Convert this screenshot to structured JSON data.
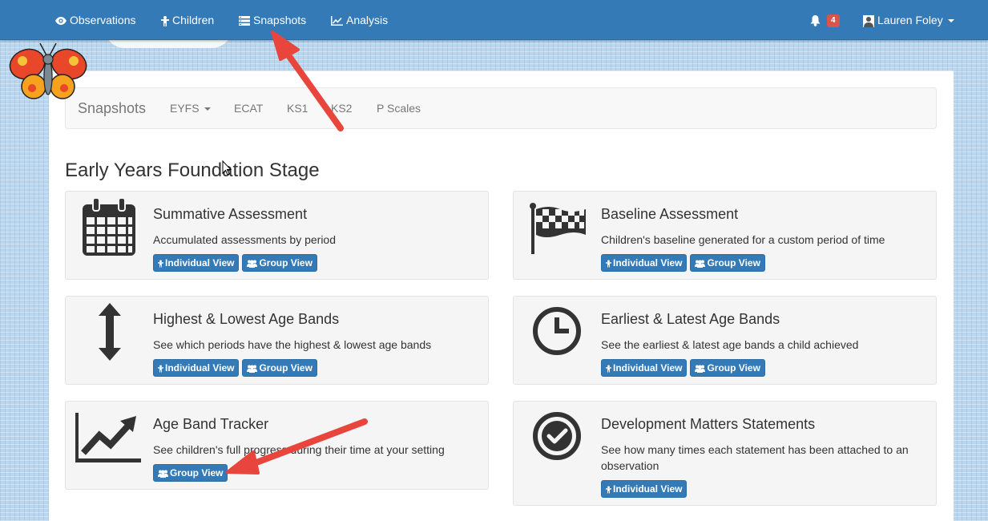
{
  "navbar": {
    "items": [
      {
        "label": "Observations",
        "icon": "eye-icon"
      },
      {
        "label": "Children",
        "icon": "child-icon"
      },
      {
        "label": "Snapshots",
        "icon": "list-icon"
      },
      {
        "label": "Analysis",
        "icon": "line-chart-icon"
      }
    ],
    "notifications": {
      "count": "4",
      "icon": "bell-icon"
    },
    "user": {
      "name": "Lauren Foley",
      "icon": "user-icon"
    }
  },
  "subnav": {
    "brand": "Snapshots",
    "items": [
      {
        "label": "EYFS",
        "dropdown": true
      },
      {
        "label": "ECAT"
      },
      {
        "label": "KS1"
      },
      {
        "label": "KS2"
      },
      {
        "label": "P Scales"
      }
    ]
  },
  "section": {
    "title": "Early Years Foundation Stage"
  },
  "cards": [
    {
      "title": "Summative Assessment",
      "desc": "Accumulated assessments by period",
      "icon": "calendar-icon",
      "buttons": [
        "Individual View",
        "Group View"
      ]
    },
    {
      "title": "Baseline Assessment",
      "desc": "Children's baseline generated for a custom period of time",
      "icon": "flag-icon",
      "buttons": [
        "Individual View",
        "Group View"
      ]
    },
    {
      "title": "Highest & Lowest Age Bands",
      "desc": "See which periods have the highest & lowest age bands",
      "icon": "vertical-arrows-icon",
      "buttons": [
        "Individual View",
        "Group View"
      ]
    },
    {
      "title": "Earliest & Latest Age Bands",
      "desc": "See the earliest & latest age bands a child achieved",
      "icon": "clock-icon",
      "buttons": [
        "Individual View",
        "Group View"
      ]
    },
    {
      "title": "Age Band Tracker",
      "desc": "See children's full progress during their time at your setting",
      "icon": "trend-chart-icon",
      "buttons": [
        "Group View"
      ]
    },
    {
      "title": "Development Matters Statements",
      "desc": "See how many times each statement has been attached to an observation",
      "icon": "check-circle-icon",
      "buttons": [
        "Individual View"
      ]
    }
  ],
  "colors": {
    "primary": "#337ab7",
    "badge": "#d9534f",
    "annotation_arrow": "#e8453c"
  }
}
